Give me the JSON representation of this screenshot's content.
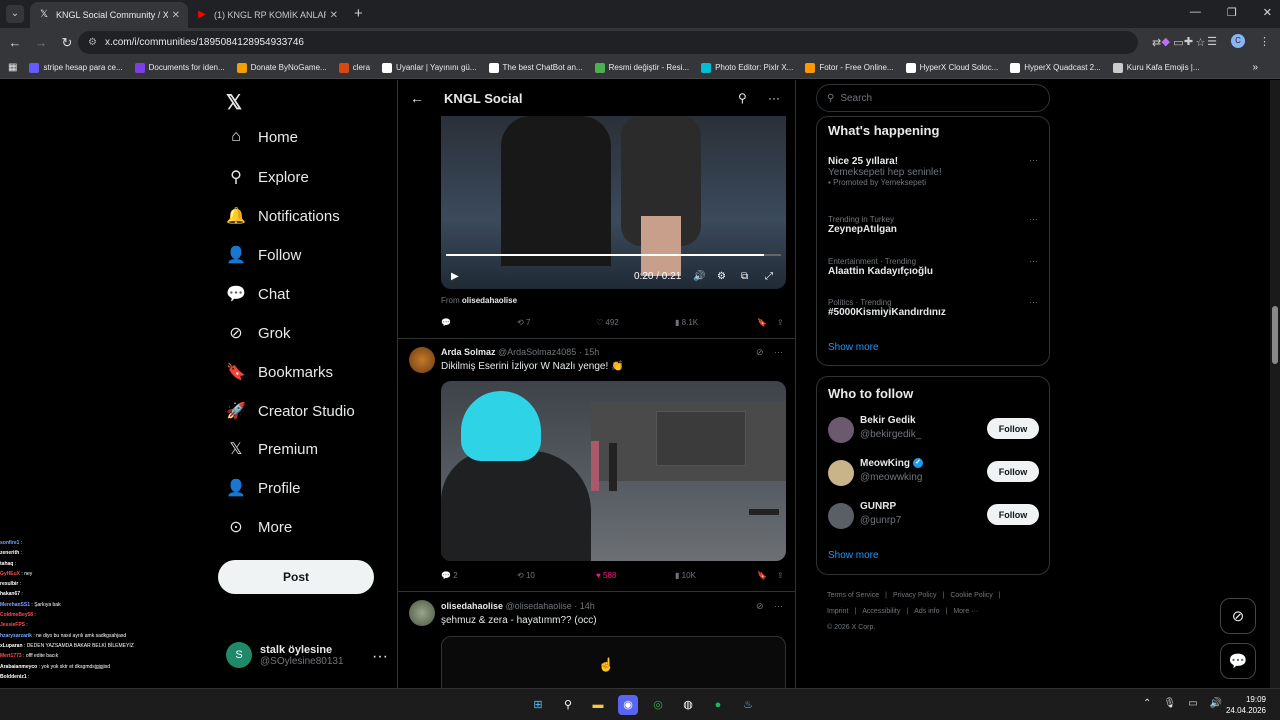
{
  "browser": {
    "tabs": [
      {
        "title": "KNGL Social Community / X",
        "icon": "x-logo-icon",
        "active": true
      },
      {
        "title": "(1) KNGL RP KOMİK ANLAR #1",
        "icon": "youtube-icon",
        "active": false
      }
    ],
    "url": "x.com/i/communities/1895084128954933746",
    "bookmarks": [
      {
        "label": "stripe hesap para ce...",
        "color": "#635bff"
      },
      {
        "label": "Documents for iden...",
        "color": "#7b3fe4"
      },
      {
        "label": "Donate ByNoGame...",
        "color": "#f0a000"
      },
      {
        "label": "clera",
        "color": "#d9480f"
      },
      {
        "label": "Uyanlar | Yayınını gü...",
        "color": "#ffffff"
      },
      {
        "label": "The best ChatBot an...",
        "color": "#ffffff"
      },
      {
        "label": "Resmi değiştir - Resi...",
        "color": "#4caf50"
      },
      {
        "label": "Photo Editor: Pixlr X...",
        "color": "#00bcd4"
      },
      {
        "label": "Fotor - Free Online...",
        "color": "#ff9800"
      },
      {
        "label": "HyperX Cloud Soloc...",
        "color": "#ffffff"
      },
      {
        "label": "HyperX Quadcast 2...",
        "color": "#ffffff"
      },
      {
        "label": "Kuru Kafa Emojis |...",
        "color": "#cccccc"
      }
    ]
  },
  "nav": {
    "items": [
      {
        "label": "Home",
        "icon": "home-icon",
        "glyph": "⌂"
      },
      {
        "label": "Explore",
        "icon": "search-icon",
        "glyph": "⚲"
      },
      {
        "label": "Notifications",
        "icon": "bell-icon",
        "glyph": "🔔"
      },
      {
        "label": "Follow",
        "icon": "add-person-icon",
        "glyph": "👤"
      },
      {
        "label": "Chat",
        "icon": "chat-icon",
        "glyph": "💬"
      },
      {
        "label": "Grok",
        "icon": "grok-icon",
        "glyph": "⊘"
      },
      {
        "label": "Bookmarks",
        "icon": "bookmark-icon",
        "glyph": "🔖"
      },
      {
        "label": "Creator Studio",
        "icon": "rocket-icon",
        "glyph": "🚀"
      },
      {
        "label": "Premium",
        "icon": "x-logo-icon",
        "glyph": "𝕏"
      },
      {
        "label": "Profile",
        "icon": "person-icon",
        "glyph": "👤"
      },
      {
        "label": "More",
        "icon": "more-circle-icon",
        "glyph": "⊙"
      }
    ],
    "post_label": "Post",
    "account": {
      "name": "stalk öylesine",
      "handle": "@SOylesine80131",
      "initial": "S"
    }
  },
  "stream_chat": [
    {
      "user": "sonfire1",
      "msg": "",
      "color": "#7aa8ff"
    },
    {
      "user": "zenerith",
      "msg": "",
      "color": "#ffffff"
    },
    {
      "user": "tahaq",
      "msg": "",
      "color": "#ffffff"
    },
    {
      "user": "GyHEuX",
      "msg": "ney",
      "color": "#ff4d4d"
    },
    {
      "user": "rexulbir",
      "msg": "",
      "color": "#ffffff"
    },
    {
      "user": "hakan67",
      "msg": "",
      "color": "#ffffff"
    },
    {
      "user": "MerehanSS1",
      "msg": "Şarkıya bak",
      "color": "#7aa8ff"
    },
    {
      "user": "ColdmeBey58",
      "msg": "",
      "color": "#ff4d4d"
    },
    {
      "user": "JessieFPS",
      "msg": "",
      "color": "#ff4d4d"
    },
    {
      "user": "hzarysarzarik",
      "msg": "ne diyo bu nasıl ayrılı amk sadkgsahjasd",
      "color": "#7aa8ff"
    },
    {
      "user": "xLuparan",
      "msg": "DEDEN YAZSAMDA BAKAR BELKİ BİLEMEYİZ",
      "color": "#ffffff"
    },
    {
      "user": "Mert1773",
      "msg": "offf edite bacık",
      "color": "#ff4d4d"
    },
    {
      "user": "Arabaianmeyco",
      "msg": "yok yok sktr et dksgmdsjgjgjisd",
      "color": "#ffffff"
    },
    {
      "user": "Bolddeniz1",
      "msg": "",
      "color": "#ffffff"
    },
    {
      "user": "Chenda",
      "msg": "",
      "color": "#ffd700"
    }
  ],
  "main": {
    "title": "KNGL Social",
    "video": {
      "time": "0:20 / 0:21",
      "progress": 0.95
    },
    "from_label": "From",
    "from_user": "olisedahaolise",
    "post1_actions": {
      "replies": "",
      "reposts": "7",
      "likes": "492",
      "views": "8.1K"
    },
    "post2": {
      "name": "Arda Solmaz",
      "handle": "@ArdaSolmaz4085",
      "time": "· 15h",
      "text": "Dikilmiş Eserini İzliyor W Nazlı yenge! 👏",
      "actions": {
        "replies": "2",
        "reposts": "10",
        "likes": "588",
        "views": "10K"
      }
    },
    "post3": {
      "name": "olisedahaolise",
      "handle": "@olisedahaolise",
      "time": "· 14h",
      "text": "şehmuz & zera - hayatımm?? (occ)"
    }
  },
  "right": {
    "search_placeholder": "Search",
    "happening_title": "What's happening",
    "trends": [
      {
        "meta": "",
        "name": "Nice 25 yıllara!",
        "sub": "Yemeksepeti hep seninle!",
        "promo": "Promoted by Yemeksepeti"
      },
      {
        "meta": "Trending in Turkey",
        "name": "ZeynepAtılgan",
        "sub": "",
        "promo": ""
      },
      {
        "meta": "Entertainment · Trending",
        "name": "Alaattin Kadayıfçıoğlu",
        "sub": "",
        "promo": ""
      },
      {
        "meta": "Politics · Trending",
        "name": "#5000KismiyiKandırdınız",
        "sub": "",
        "promo": ""
      }
    ],
    "show_more": "Show more",
    "wtf_title": "Who to follow",
    "who_to_follow": [
      {
        "name": "Bekir Gedik",
        "handle": "@bekirgedik_",
        "verified": false,
        "avatar_color": "#6b5a6e"
      },
      {
        "name": "MeowKing",
        "handle": "@meowwking",
        "verified": true,
        "avatar_color": "#c9b48a"
      },
      {
        "name": "GUNRP",
        "handle": "@gunrp7",
        "verified": false,
        "avatar_color": "#5a5f66"
      }
    ],
    "follow_label": "Follow",
    "footer": [
      "Terms of Service",
      "|",
      "Privacy Policy",
      "|",
      "Cookie Policy",
      "|",
      "Imprint",
      "|",
      "Accessibility",
      "|",
      "Ads info",
      "|",
      "More ···",
      "© 2026 X Corp."
    ]
  },
  "taskbar": {
    "time": "19:09",
    "date": "24.04.2026"
  }
}
